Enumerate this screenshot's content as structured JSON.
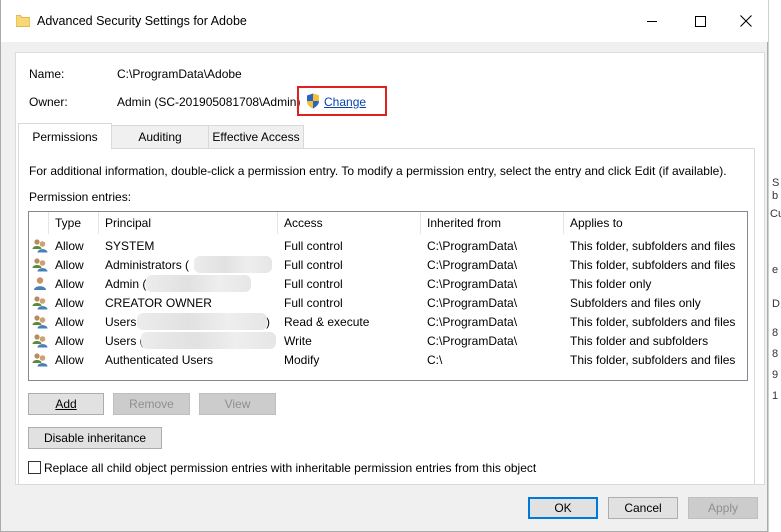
{
  "window": {
    "title": "Advanced Security Settings for Adobe"
  },
  "info": {
    "name_label": "Name:",
    "name_value": "C:\\ProgramData\\Adobe",
    "owner_label": "Owner:",
    "owner_value": "Admin (SC-201905081708\\Admin)",
    "change_link": "Change"
  },
  "tabs": [
    {
      "label": "Permissions",
      "active": true
    },
    {
      "label": "Auditing",
      "active": false
    },
    {
      "label": "Effective Access",
      "active": false
    }
  ],
  "permissions": {
    "instructions": "For additional information, double-click a permission entry. To modify a permission entry, select the entry and click Edit (if available).",
    "entries_label": "Permission entries:",
    "columns": [
      "Type",
      "Principal",
      "Access",
      "Inherited from",
      "Applies to"
    ],
    "rows": [
      {
        "type": "Allow",
        "principal": "SYSTEM",
        "access": "Full control",
        "inherited": "C:\\ProgramData\\",
        "applies": "This folder, subfolders and files",
        "icon": "users-group-icon"
      },
      {
        "type": "Allow",
        "principal": "Administrators (",
        "access": "Full control",
        "inherited": "C:\\ProgramData\\",
        "applies": "This folder, subfolders and files",
        "icon": "users-group-icon"
      },
      {
        "type": "Allow",
        "principal": "Admin (",
        "access": "Full control",
        "inherited": "C:\\ProgramData\\",
        "applies": "This folder only",
        "icon": "user-icon"
      },
      {
        "type": "Allow",
        "principal": "CREATOR OWNER",
        "access": "Full control",
        "inherited": "C:\\ProgramData\\",
        "applies": "Subfolders and files only",
        "icon": "users-group-icon"
      },
      {
        "type": "Allow",
        "principal": "Users (",
        "principal_tail": "s)",
        "access": "Read & execute",
        "inherited": "C:\\ProgramData\\",
        "applies": "This folder, subfolders and files",
        "icon": "users-group-icon"
      },
      {
        "type": "Allow",
        "principal": "Users (S",
        "access": "Write",
        "inherited": "C:\\ProgramData\\",
        "applies": "This folder and subfolders",
        "icon": "users-group-icon"
      },
      {
        "type": "Allow",
        "principal": "Authenticated Users",
        "access": "Modify",
        "inherited": "C:\\",
        "applies": "This folder, subfolders and files",
        "icon": "users-group-icon"
      }
    ],
    "buttons": {
      "add": "Add",
      "remove": "Remove",
      "view": "View"
    },
    "disable_inheritance": "Disable inheritance",
    "replace_checkbox": "Replace all child object permission entries with inheritable permission entries from this object",
    "replace_checked": false
  },
  "footer": {
    "ok": "OK",
    "cancel": "Cancel",
    "apply": "Apply"
  },
  "right_strip_chars": [
    "S",
    "b",
    "Cu",
    "e",
    "D",
    "8",
    "8",
    "9",
    "1"
  ],
  "colors": {
    "highlight": "#e02020",
    "link": "#0645ad",
    "accent": "#0078d7"
  }
}
